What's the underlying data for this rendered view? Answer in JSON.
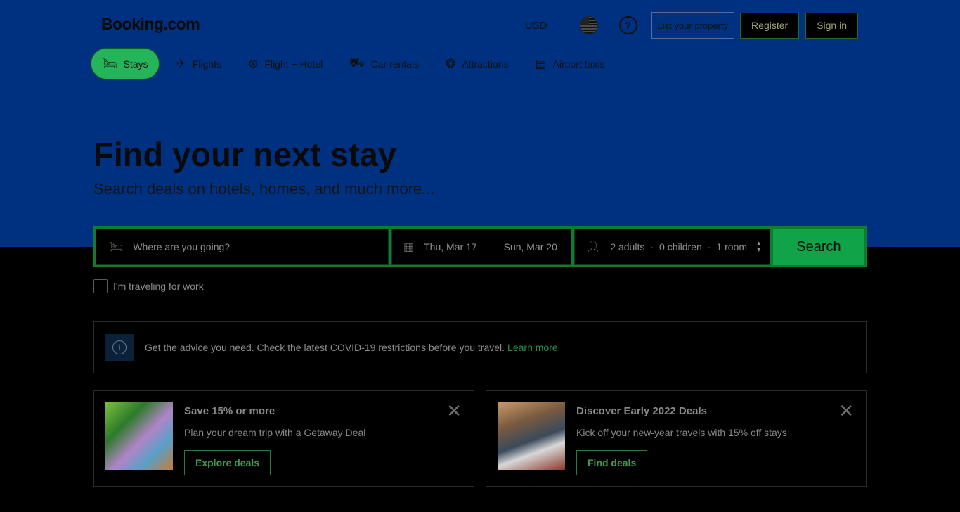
{
  "header": {
    "logo": "Booking.com",
    "currency": "USD",
    "help_icon": "?",
    "list_property": "List your property",
    "register": "Register",
    "sign_in": "Sign in"
  },
  "nav": {
    "items": [
      {
        "label": "Stays",
        "icon": "bed-icon"
      },
      {
        "label": "Flights",
        "icon": "plane-icon"
      },
      {
        "label": "Flight + Hotel",
        "icon": "flight-hotel-icon"
      },
      {
        "label": "Car rentals",
        "icon": "car-icon"
      },
      {
        "label": "Attractions",
        "icon": "attractions-icon"
      },
      {
        "label": "Airport taxis",
        "icon": "taxi-icon"
      }
    ]
  },
  "hero": {
    "title": "Find your next stay",
    "subtitle": "Search deals on hotels, homes, and much more..."
  },
  "search": {
    "destination_placeholder": "Where are you going?",
    "check_in": "Thu, Mar 17",
    "date_separator": "—",
    "check_out": "Sun, Mar 20",
    "adults": "2 adults",
    "children": "0 children",
    "rooms": "1 room",
    "guests_separator": "·",
    "search_button": "Search",
    "work_travel_label": "I'm traveling for work"
  },
  "alert": {
    "icon_glyph": "i",
    "text": "Get the advice you need. Check the latest COVID-19 restrictions before you travel.",
    "link": "Learn more"
  },
  "promos": [
    {
      "title": "Save 15% or more",
      "description": "Plan your dream trip with a Getaway Deal",
      "button": "Explore deals",
      "close": "✕"
    },
    {
      "title": "Discover Early 2022 Deals",
      "description": "Kick off your new-year travels with 15% off stays",
      "button": "Find deals",
      "close": "✕"
    }
  ],
  "colors": {
    "hero_bg": "#003181",
    "accent_green": "#10a347",
    "page_bg": "#000000"
  }
}
